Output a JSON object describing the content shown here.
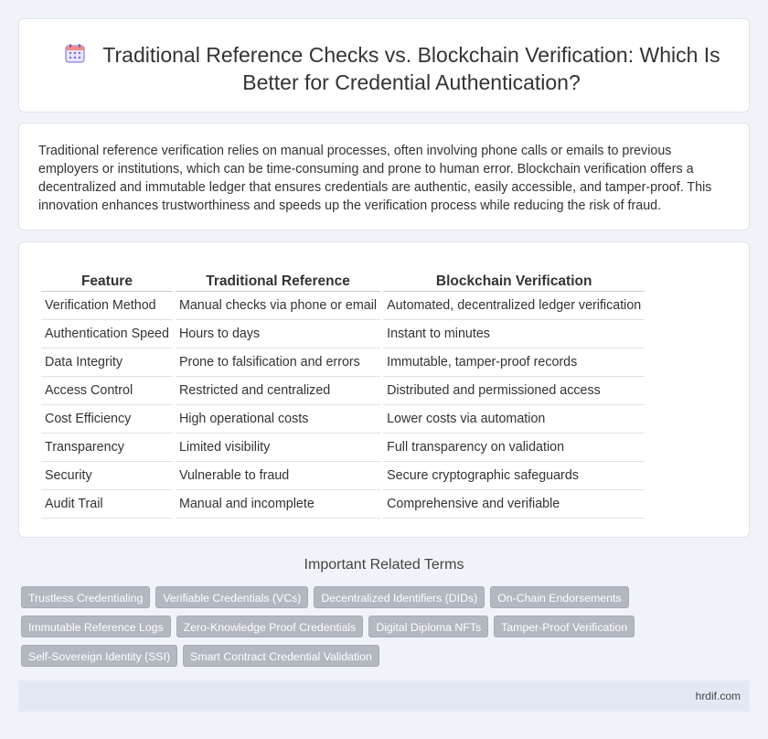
{
  "header": {
    "title": "Traditional Reference Checks vs. Blockchain Verification: Which Is Better for Credential Authentication?",
    "icon": "calendar-icon"
  },
  "intro": {
    "text": "Traditional reference verification relies on manual processes, often involving phone calls or emails to previous employers or institutions, which can be time-consuming and prone to human error. Blockchain verification offers a decentralized and immutable ledger that ensures credentials are authentic, easily accessible, and tamper-proof. This innovation enhances trustworthiness and speeds up the verification process while reducing the risk of fraud."
  },
  "table": {
    "headers": [
      "Feature",
      "Traditional Reference",
      "Blockchain Verification"
    ],
    "rows": [
      [
        "Verification Method",
        "Manual checks via phone or email",
        "Automated, decentralized ledger verification"
      ],
      [
        "Authentication Speed",
        "Hours to days",
        "Instant to minutes"
      ],
      [
        "Data Integrity",
        "Prone to falsification and errors",
        "Immutable, tamper-proof records"
      ],
      [
        "Access Control",
        "Restricted and centralized",
        "Distributed and permissioned access"
      ],
      [
        "Cost Efficiency",
        "High operational costs",
        "Lower costs via automation"
      ],
      [
        "Transparency",
        "Limited visibility",
        "Full transparency on validation"
      ],
      [
        "Security",
        "Vulnerable to fraud",
        "Secure cryptographic safeguards"
      ],
      [
        "Audit Trail",
        "Manual and incomplete",
        "Comprehensive and verifiable"
      ]
    ]
  },
  "related": {
    "heading": "Important Related Terms",
    "tags": [
      "Trustless Credentialing",
      "Verifiable Credentials (VCs)",
      "Decentralized Identifiers (DIDs)",
      "On-Chain Endorsements",
      "Immutable Reference Logs",
      "Zero-Knowledge Proof Credentials",
      "Digital Diploma NFTs",
      "Tamper-Proof Verification",
      "Self-Sovereign Identity (SSI)",
      "Smart Contract Credential Validation"
    ]
  },
  "footer": {
    "site": "hrdif.com"
  },
  "colors": {
    "page_bg": "#f0f3f8",
    "tag_bg": "#b2b8c0",
    "footer_bg": "#e3e9f4",
    "icon_accent": "#7b6fd0"
  }
}
